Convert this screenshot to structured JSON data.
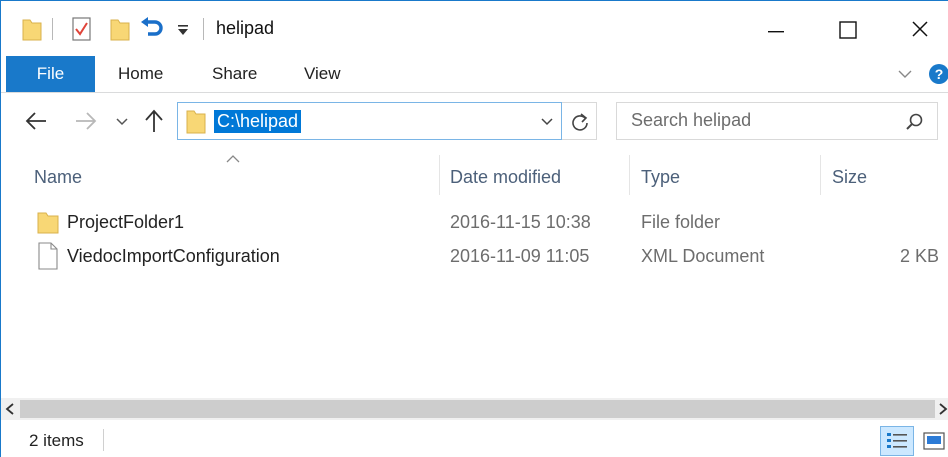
{
  "window": {
    "title": "helipad"
  },
  "ribbon": {
    "tabs": [
      "File",
      "Home",
      "Share",
      "View"
    ]
  },
  "nav": {
    "address": "C:\\helipad",
    "search_placeholder": "Search helipad"
  },
  "columns": {
    "name": "Name",
    "date": "Date modified",
    "type": "Type",
    "size": "Size"
  },
  "files": [
    {
      "name": "ProjectFolder1",
      "date": "2016-11-15 10:38",
      "type": "File folder",
      "size": "",
      "icon": "folder-icon"
    },
    {
      "name": "ViedocImportConfiguration",
      "date": "2016-11-09 11:05",
      "type": "XML Document",
      "size": "2 KB",
      "icon": "document-icon"
    }
  ],
  "status": {
    "item_count": "2 items"
  },
  "colors": {
    "accent": "#1979ca",
    "selection": "#0078d7",
    "folder": "#f8d775"
  }
}
